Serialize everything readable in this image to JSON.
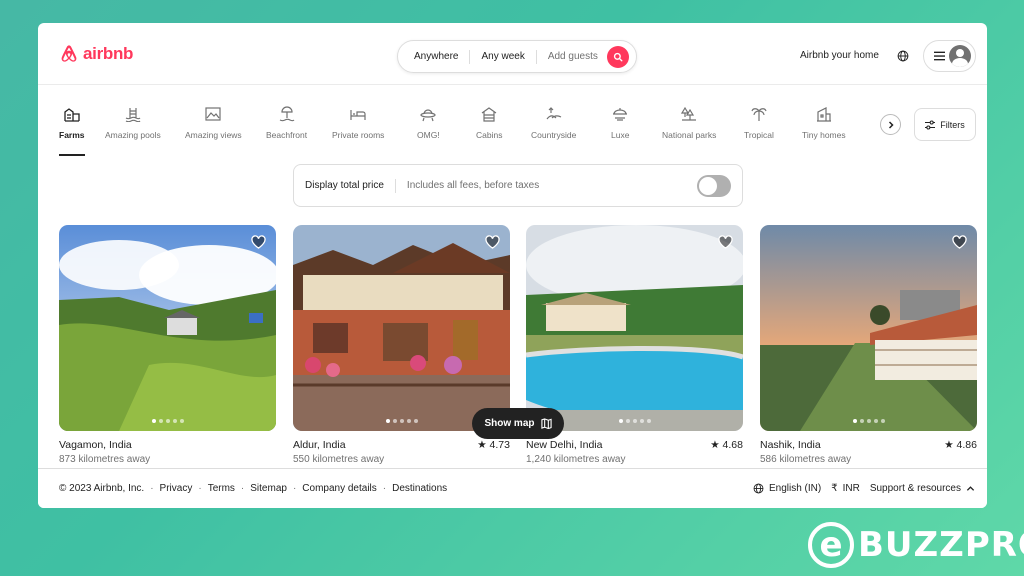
{
  "header": {
    "logo_text": "airbnb",
    "search": {
      "where": "Anywhere",
      "when": "Any week",
      "guests": "Add guests"
    },
    "host_link": "Airbnb your home"
  },
  "categories": [
    {
      "label": "Farms",
      "icon": "farm-icon",
      "active": true
    },
    {
      "label": "Amazing pools",
      "icon": "pool-icon"
    },
    {
      "label": "Amazing views",
      "icon": "views-icon"
    },
    {
      "label": "Beachfront",
      "icon": "beach-icon"
    },
    {
      "label": "Private rooms",
      "icon": "bed-icon"
    },
    {
      "label": "OMG!",
      "icon": "ufo-icon"
    },
    {
      "label": "Cabins",
      "icon": "cabin-icon"
    },
    {
      "label": "Countryside",
      "icon": "countryside-icon"
    },
    {
      "label": "Luxe",
      "icon": "luxe-icon"
    },
    {
      "label": "National parks",
      "icon": "park-icon"
    },
    {
      "label": "Tropical",
      "icon": "palm-icon"
    },
    {
      "label": "Tiny homes",
      "icon": "tiny-home-icon"
    }
  ],
  "filters_label": "Filters",
  "price_toggle": {
    "title": "Display total price",
    "subtitle": "Includes all fees, before taxes",
    "enabled": false
  },
  "listings": [
    {
      "location": "Vagamon, India",
      "distance": "873 kilometres away",
      "rating": ""
    },
    {
      "location": "Aldur, India",
      "distance": "550 kilometres away",
      "rating": "★ 4.73"
    },
    {
      "location": "New Delhi, India",
      "distance": "1,240 kilometres away",
      "rating": "★ 4.68"
    },
    {
      "location": "Nashik, India",
      "distance": "586 kilometres away",
      "rating": "★ 4.86"
    }
  ],
  "show_map_label": "Show map",
  "footer": {
    "copyright": "© 2023 Airbnb, Inc.",
    "links": [
      "Privacy",
      "Terms",
      "Sitemap",
      "Company details",
      "Destinations"
    ],
    "language": "English (IN)",
    "currency_symbol": "₹",
    "currency": "INR",
    "support": "Support & resources"
  },
  "watermark": "BUZZPRO",
  "colors": {
    "brand": "#ff385c",
    "text": "#222222",
    "muted": "#717171"
  }
}
